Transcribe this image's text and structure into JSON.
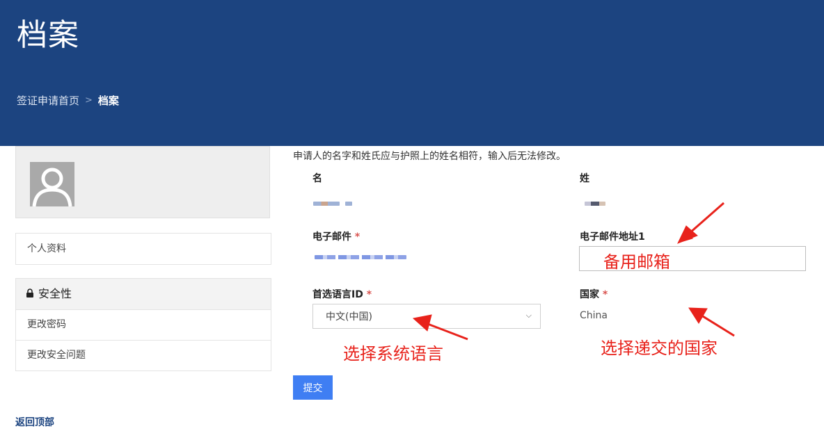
{
  "header": {
    "title": "档案",
    "breadcrumb": [
      {
        "label": "签证申请首页"
      },
      {
        "label": "档案"
      }
    ],
    "breadcrumb_separator": ">"
  },
  "sidebar": {
    "avatar_icon": "user-avatar-icon",
    "profile_label": "个人资料",
    "security": {
      "icon": "lock-icon",
      "label": "安全性",
      "items": [
        {
          "label": "更改密码"
        },
        {
          "label": "更改安全问题"
        }
      ]
    }
  },
  "main": {
    "notice": "申请人的名字和姓氏应与护照上的姓名相符，输入后无法修改。",
    "first_name_label": "名",
    "last_name_label": "姓",
    "email_label": "电子邮件",
    "email2_label": "电子邮件地址1",
    "email2_value": "",
    "language_label": "首选语言ID",
    "language_value": "中文(中国)",
    "country_label": "国家",
    "country_value": "China",
    "required_mark": "*",
    "submit_label": "提交"
  },
  "annotations": {
    "email2": "备用邮箱",
    "language": "选择系统语言",
    "country": "选择递交的国家",
    "color": "#e8221b"
  },
  "footer": {
    "back_to_top": "返回顶部"
  },
  "colors": {
    "header_bg": "#1c4480",
    "submit_bg": "#3f7ef3",
    "required": "#d9534f"
  }
}
